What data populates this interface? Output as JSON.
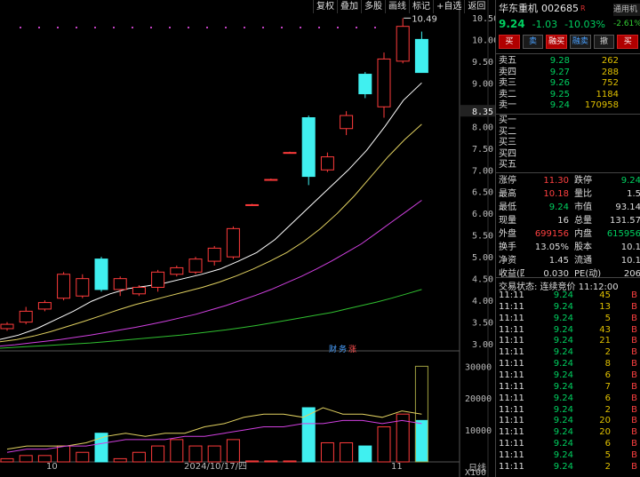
{
  "toolbar": [
    "复权",
    "叠加",
    "多股",
    "画线",
    "标记",
    "+自选",
    "返回"
  ],
  "stock": {
    "name": "华东重机",
    "code": "002685",
    "badge": "R",
    "price": "9.24",
    "change": "-1.03",
    "pct": "-10.03%",
    "side_tag": "通用机",
    "side_pct": "-2.61%"
  },
  "trade_buttons": [
    "买",
    "卖",
    "融买",
    "融卖",
    "撤",
    "买"
  ],
  "ask": [
    {
      "label": "卖五",
      "price": "9.28",
      "vol": "262"
    },
    {
      "label": "卖四",
      "price": "9.27",
      "vol": "288"
    },
    {
      "label": "卖三",
      "price": "9.26",
      "vol": "752"
    },
    {
      "label": "卖二",
      "price": "9.25",
      "vol": "1184"
    },
    {
      "label": "卖一",
      "price": "9.24",
      "vol": "170958"
    }
  ],
  "bid": [
    {
      "label": "买一",
      "price": "",
      "vol": ""
    },
    {
      "label": "买二",
      "price": "",
      "vol": ""
    },
    {
      "label": "买三",
      "price": "",
      "vol": ""
    },
    {
      "label": "买四",
      "price": "",
      "vol": ""
    },
    {
      "label": "买五",
      "price": "",
      "vol": ""
    }
  ],
  "stats": [
    [
      "涨停",
      "11.30",
      "跌停",
      "9.24"
    ],
    [
      "最高",
      "10.18",
      "量比",
      "1.5"
    ],
    [
      "最低",
      "9.24",
      "市值",
      "93.14"
    ],
    [
      "现量",
      "16",
      "总量",
      "131.57"
    ],
    [
      "外盘",
      "699156",
      "内盘",
      "615956"
    ],
    [
      "换手",
      "13.05%",
      "股本",
      "10.1"
    ],
    [
      "净资",
      "1.45",
      "流通",
      "10.1"
    ],
    [
      "收益(四)",
      "0.030",
      "PE(动)",
      "206"
    ]
  ],
  "trade_status": "交易状态: 连续竞价 11:12:00",
  "tape": [
    {
      "t": "11:11",
      "p": "9.24",
      "v": "45",
      "s": "B"
    },
    {
      "t": "11:11",
      "p": "9.24",
      "v": "13",
      "s": "B"
    },
    {
      "t": "11:11",
      "p": "9.24",
      "v": "5",
      "s": "B"
    },
    {
      "t": "11:11",
      "p": "9.24",
      "v": "43",
      "s": "B"
    },
    {
      "t": "11:11",
      "p": "9.24",
      "v": "21",
      "s": "B"
    },
    {
      "t": "11:11",
      "p": "9.24",
      "v": "2",
      "s": "B"
    },
    {
      "t": "11:11",
      "p": "9.24",
      "v": "8",
      "s": "B"
    },
    {
      "t": "11:11",
      "p": "9.24",
      "v": "6",
      "s": "B"
    },
    {
      "t": "11:11",
      "p": "9.24",
      "v": "7",
      "s": "B"
    },
    {
      "t": "11:11",
      "p": "9.24",
      "v": "6",
      "s": "B"
    },
    {
      "t": "11:11",
      "p": "9.24",
      "v": "2",
      "s": "B"
    },
    {
      "t": "11:11",
      "p": "9.24",
      "v": "20",
      "s": "B"
    },
    {
      "t": "11:11",
      "p": "9.24",
      "v": "20",
      "s": "B"
    },
    {
      "t": "11:11",
      "p": "9.24",
      "v": "6",
      "s": "B"
    },
    {
      "t": "11:11",
      "p": "9.24",
      "v": "5",
      "s": "B"
    },
    {
      "t": "11:11",
      "p": "9.24",
      "v": "2",
      "s": "B"
    }
  ],
  "colors": {
    "up": "#ff3b3b",
    "down": "#40f0f0",
    "ma5": "#ffffff",
    "ma10": "#e0d060",
    "ma20": "#d040e0",
    "ma60": "#30c030",
    "vol_ma1": "#e0d060",
    "vol_ma2": "#d040e0"
  },
  "chart_data": {
    "type": "candlestick",
    "price_axis": [
      "10.50",
      "10.00",
      "9.50",
      "9.00",
      "8.35",
      "8.00",
      "7.50",
      "7.00",
      "6.50",
      "6.00",
      "5.50",
      "5.00",
      "4.50",
      "4.00",
      "3.50",
      "3.00"
    ],
    "price_axis_current": "8.35",
    "volume_axis": [
      "30000",
      "20000",
      "10000",
      "X100"
    ],
    "x_labels": [
      "10",
      "2024/10/17/四",
      "11"
    ],
    "period_label": "日线",
    "annotation_high": "10.49",
    "finance_labels": [
      "财",
      "务",
      "涨"
    ],
    "candles": [
      {
        "o": 3.35,
        "c": 3.45,
        "h": 3.5,
        "l": 3.3
      },
      {
        "o": 3.5,
        "c": 3.75,
        "h": 3.85,
        "l": 3.45
      },
      {
        "o": 3.8,
        "c": 3.95,
        "h": 4.0,
        "l": 3.75
      },
      {
        "o": 4.05,
        "c": 4.6,
        "h": 4.65,
        "l": 4.0
      },
      {
        "o": 4.1,
        "c": 4.5,
        "h": 4.6,
        "l": 4.05
      },
      {
        "o": 4.95,
        "c": 4.25,
        "h": 5.0,
        "l": 4.2
      },
      {
        "o": 4.25,
        "c": 4.5,
        "h": 4.55,
        "l": 4.1
      },
      {
        "o": 4.15,
        "c": 4.3,
        "h": 4.35,
        "l": 4.1
      },
      {
        "o": 4.3,
        "c": 4.65,
        "h": 4.7,
        "l": 4.2
      },
      {
        "o": 4.6,
        "c": 4.75,
        "h": 4.8,
        "l": 4.55
      },
      {
        "o": 4.65,
        "c": 4.95,
        "h": 5.0,
        "l": 4.6
      },
      {
        "o": 4.9,
        "c": 5.2,
        "h": 5.25,
        "l": 4.8
      },
      {
        "o": 5.0,
        "c": 5.65,
        "h": 5.7,
        "l": 4.95
      },
      {
        "o": 6.2,
        "c": 6.2,
        "h": 6.22,
        "l": 6.18
      },
      {
        "o": 6.78,
        "c": 6.78,
        "h": 6.8,
        "l": 6.76
      },
      {
        "o": 7.4,
        "c": 7.4,
        "h": 7.42,
        "l": 7.38
      },
      {
        "o": 8.2,
        "c": 6.85,
        "h": 8.25,
        "l": 6.65
      },
      {
        "o": 7.0,
        "c": 7.3,
        "h": 7.4,
        "l": 6.95
      },
      {
        "o": 7.95,
        "c": 8.25,
        "h": 8.35,
        "l": 7.8
      },
      {
        "o": 9.2,
        "c": 8.75,
        "h": 9.25,
        "l": 8.65
      },
      {
        "o": 8.45,
        "c": 9.55,
        "h": 9.7,
        "l": 8.2
      },
      {
        "o": 9.5,
        "c": 10.3,
        "h": 10.49,
        "l": 9.45
      },
      {
        "o": 10.0,
        "c": 9.24,
        "h": 10.18,
        "l": 9.24
      }
    ],
    "volumes": [
      1,
      2,
      2,
      5,
      3,
      9,
      1,
      3,
      5,
      7,
      5,
      5,
      7,
      0.3,
      0.3,
      0.3,
      17,
      6,
      6,
      5,
      11,
      15,
      13
    ],
    "ma5": [
      3.1,
      3.2,
      3.35,
      3.55,
      3.75,
      3.98,
      4.15,
      4.27,
      4.33,
      4.4,
      4.5,
      4.6,
      4.72,
      4.9,
      5.1,
      5.4,
      5.8,
      6.2,
      6.6,
      7.0,
      7.45,
      8.0,
      8.6,
      9.0
    ],
    "ma10": [
      3.05,
      3.1,
      3.18,
      3.28,
      3.4,
      3.52,
      3.65,
      3.78,
      3.9,
      4.0,
      4.1,
      4.2,
      4.3,
      4.42,
      4.56,
      4.72,
      4.9,
      5.1,
      5.35,
      5.65,
      6.0,
      6.4,
      6.85,
      7.3,
      7.7,
      8.05
    ],
    "ma20": [
      2.95,
      2.98,
      3.02,
      3.06,
      3.1,
      3.15,
      3.2,
      3.26,
      3.32,
      3.38,
      3.45,
      3.52,
      3.6,
      3.68,
      3.78,
      3.88,
      4.0,
      4.12,
      4.25,
      4.4,
      4.55,
      4.72,
      4.9,
      5.1,
      5.3,
      5.55,
      5.8,
      6.05,
      6.3
    ],
    "ma60": [
      2.9,
      2.92,
      2.94,
      2.96,
      2.98,
      3.0,
      3.02,
      3.05,
      3.08,
      3.11,
      3.14,
      3.17,
      3.2,
      3.24,
      3.28,
      3.32,
      3.37,
      3.42,
      3.48,
      3.54,
      3.6,
      3.66,
      3.72,
      3.8,
      3.88,
      3.96,
      4.05,
      4.15,
      4.25
    ],
    "vol_ma1": [
      4,
      5,
      5,
      5,
      6,
      8,
      9,
      8,
      9,
      9,
      11,
      12,
      14,
      15,
      15,
      14,
      17,
      15,
      15,
      14,
      16,
      15
    ],
    "vol_ma2": [
      3,
      4,
      4,
      5,
      5,
      6,
      7,
      7,
      7,
      8,
      8,
      9,
      10,
      11,
      11,
      12,
      12,
      13,
      13,
      12,
      13,
      12
    ]
  }
}
